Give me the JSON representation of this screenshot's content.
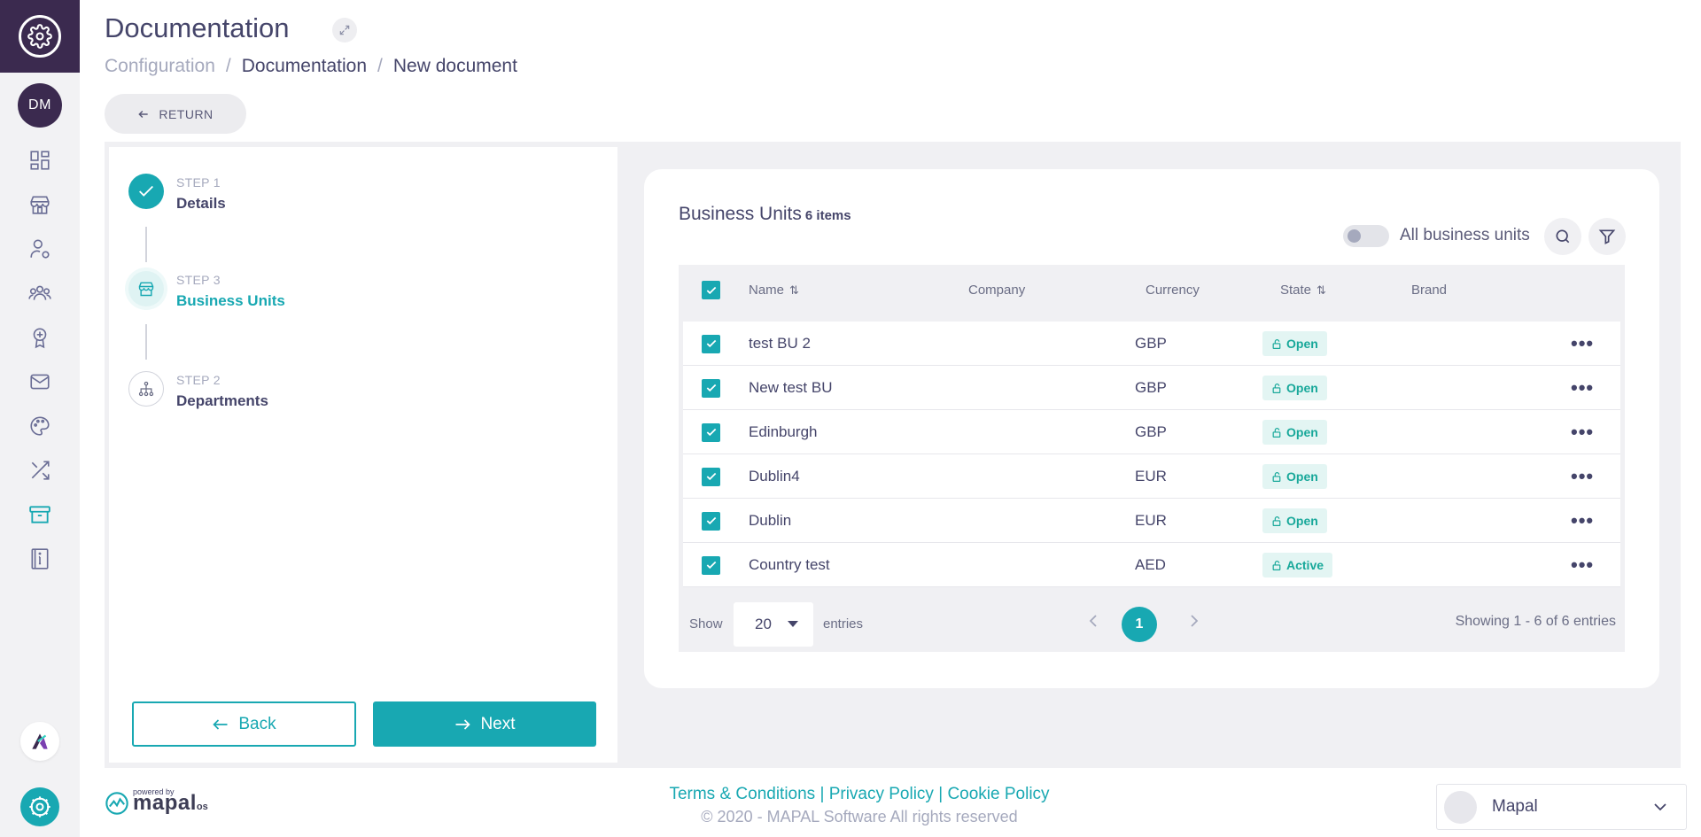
{
  "header": {
    "title": "Documentation",
    "breadcrumb": [
      "Configuration",
      "Documentation",
      "New document"
    ],
    "return_label": "RETURN"
  },
  "user": {
    "initials": "DM"
  },
  "sidebar": {
    "icons": [
      "dashboard-icon",
      "store-icon",
      "user-settings-icon",
      "team-icon",
      "award-icon",
      "mail-icon",
      "palette-icon",
      "shuffle-icon",
      "archive-icon",
      "info-book-icon"
    ]
  },
  "steps": [
    {
      "label": "STEP 1",
      "title": "Details",
      "state": "done"
    },
    {
      "label": "STEP 3",
      "title": "Business Units",
      "state": "active"
    },
    {
      "label": "STEP 2",
      "title": "Departments",
      "state": "pending"
    }
  ],
  "actions": {
    "back": "Back",
    "next": "Next"
  },
  "business_units": {
    "title": "Business Units",
    "count": "6 items",
    "toggle_label": "All business units",
    "columns": [
      "Name",
      "Company",
      "Currency",
      "State",
      "Brand"
    ],
    "rows": [
      {
        "name": "test BU 2",
        "company": "",
        "currency": "GBP",
        "state": "Open",
        "brand": ""
      },
      {
        "name": "New test BU",
        "company": "",
        "currency": "GBP",
        "state": "Open",
        "brand": ""
      },
      {
        "name": "Edinburgh",
        "company": "",
        "currency": "GBP",
        "state": "Open",
        "brand": ""
      },
      {
        "name": "Dublin4",
        "company": "",
        "currency": "EUR",
        "state": "Open",
        "brand": ""
      },
      {
        "name": "Dublin",
        "company": "",
        "currency": "EUR",
        "state": "Open",
        "brand": ""
      },
      {
        "name": "Country test",
        "company": "",
        "currency": "AED",
        "state": "Active",
        "brand": ""
      }
    ],
    "show_label": "Show",
    "page_size": "20",
    "entries_label": "entries",
    "current_page": "1",
    "showing": "Showing 1 - 6 of 6 entries"
  },
  "footer": {
    "powered_by": "powered by",
    "brand": "mapal",
    "brand_suffix": "os",
    "terms": "Terms & Conditions",
    "privacy": "Privacy Policy",
    "cookie": "Cookie Policy",
    "separator": "|",
    "copyright": "© 2020 - MAPAL Software All rights reserved",
    "company": "Mapal"
  },
  "colors": {
    "accent": "#18a8b2",
    "brand_dark": "#3b2a4f",
    "text": "#45456a",
    "muted": "#a5a9bd"
  }
}
